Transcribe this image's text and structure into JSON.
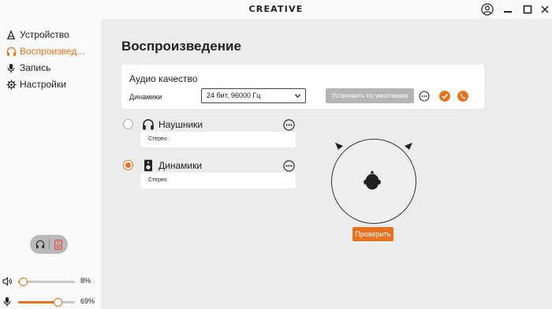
{
  "app": {
    "brand": "CREATIVE"
  },
  "window_controls": {
    "icons": [
      "account-icon",
      "minimize-icon",
      "maximize-icon",
      "close-icon"
    ]
  },
  "sidebar": {
    "items": [
      {
        "label": "Устройство",
        "icon": "device-icon",
        "active": false
      },
      {
        "label": "Воспроизвед...",
        "icon": "headphones-icon",
        "active": true
      },
      {
        "label": "Запись",
        "icon": "microphone-icon",
        "active": false
      },
      {
        "label": "Настройки",
        "icon": "gear-icon",
        "active": false
      }
    ],
    "output_toggle": {
      "left": "headphones-icon",
      "right": "speaker-icon",
      "selected": "speaker-icon"
    },
    "volume": {
      "value": 8,
      "label": "8%"
    },
    "mic": {
      "value": 69,
      "label": "69%"
    }
  },
  "main": {
    "title": "Воспроизведение",
    "audio_quality": {
      "title": "Аудио качество",
      "device_label": "Динамики",
      "format_value": "24 бит, 96000 Гц",
      "default_button": "Установить по умолчанию"
    },
    "devices": [
      {
        "name": "Наушники",
        "mode": "Стерео",
        "selected": false,
        "icon": "headphones-icon"
      },
      {
        "name": "Динамики",
        "mode": "Стерео",
        "selected": true,
        "icon": "speaker-icon"
      }
    ],
    "test_button": "Проверить"
  },
  "colors": {
    "accent": "#e8711e",
    "panel": "#fafafa",
    "background": "#ececec",
    "disabled_button": "#b5b5b5"
  }
}
